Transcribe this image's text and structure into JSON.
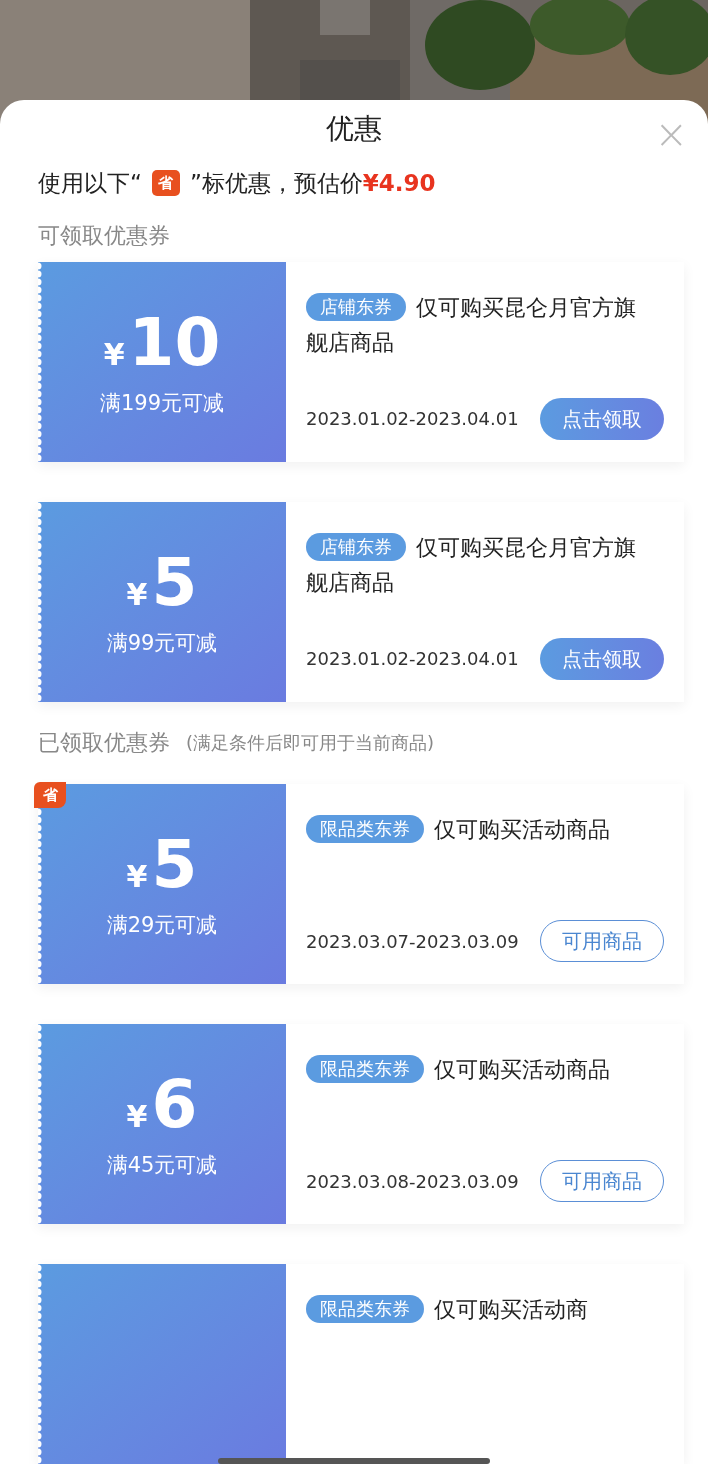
{
  "sheet": {
    "title": "优惠",
    "close": "×"
  },
  "estimate": {
    "prefix": "使用以下“",
    "badge": "省",
    "middle": "”标优惠，预估价",
    "price": "¥4.90"
  },
  "available": {
    "heading": "可领取优惠券",
    "coupons": [
      {
        "currency": "¥",
        "amount": "10",
        "condition": "满199元可减",
        "tag": "店铺东券",
        "description": "仅可购买昆仑月官方旗舰店商品",
        "dates": "2023.01.02-2023.04.01",
        "button": {
          "label": "点击领取",
          "kind": "claim"
        }
      },
      {
        "currency": "¥",
        "amount": "5",
        "condition": "满99元可减",
        "tag": "店铺东券",
        "description": "仅可购买昆仑月官方旗舰店商品",
        "dates": "2023.01.02-2023.04.01",
        "button": {
          "label": "点击领取",
          "kind": "claim"
        }
      }
    ]
  },
  "received": {
    "heading": "已领取优惠券",
    "note": "(满足条件后即可用于当前商品)",
    "coupons": [
      {
        "badge": "省",
        "currency": "¥",
        "amount": "5",
        "condition": "满29元可减",
        "tag": "限品类东券",
        "description": "仅可购买活动商品",
        "dates": "2023.03.07-2023.03.09",
        "button": {
          "label": "可用商品",
          "kind": "view"
        }
      },
      {
        "currency": "¥",
        "amount": "6",
        "condition": "满45元可减",
        "tag": "限品类东券",
        "description": "仅可购买活动商品",
        "dates": "2023.03.08-2023.03.09",
        "button": {
          "label": "可用商品",
          "kind": "view"
        }
      },
      {
        "tag": "限品类东券",
        "description": "仅可购买活动商"
      }
    ]
  }
}
